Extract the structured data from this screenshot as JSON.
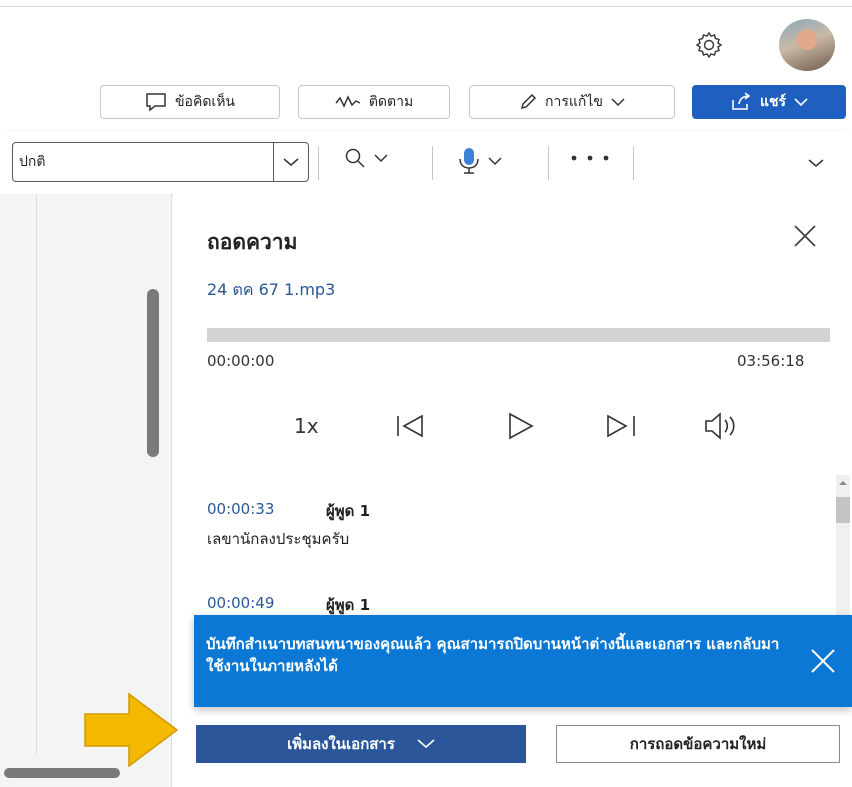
{
  "ribbon": {
    "comments_label": "ข้อคิดเห็น",
    "track_label": "ติดตาม",
    "editing_label": "การแก้ไข",
    "share_label": "แชร์",
    "style_value": "ปกติ",
    "icons": [
      "gear-icon",
      "avatar",
      "comment-icon",
      "track-changes-icon",
      "pencil-icon",
      "share-icon",
      "search-icon",
      "microphone-icon",
      "more-icon",
      "chevron-down-icon"
    ],
    "accent_color": "#1f5fbf"
  },
  "transcript_panel": {
    "title": "ถอดความ",
    "file_name": "24 ตค 67 1.mp3",
    "time_start": "00:00:00",
    "time_end": "03:56:18",
    "playback_speed": "1x",
    "progress": 0,
    "entries": [
      {
        "timestamp": "00:00:33",
        "speaker": "ผู้พูด 1",
        "text": "เลขานักลงประชุมครับ"
      },
      {
        "timestamp": "00:00:49",
        "speaker": "ผู้พูด 1",
        "text": ""
      }
    ],
    "toast": {
      "message": "บันทึกสำเนาบทสนทนาของคุณแล้ว คุณสามารถปิดบานหน้าต่างนี้และเอกสาร และกลับมาใช้งานในภายหลังได้",
      "color": "#0a78d4"
    },
    "add_to_document_label": "เพิ่มลงในเอกสาร",
    "new_transcription_label": "การถอดข้อความใหม่"
  },
  "annotation": {
    "arrow_color": "#f5b800"
  }
}
